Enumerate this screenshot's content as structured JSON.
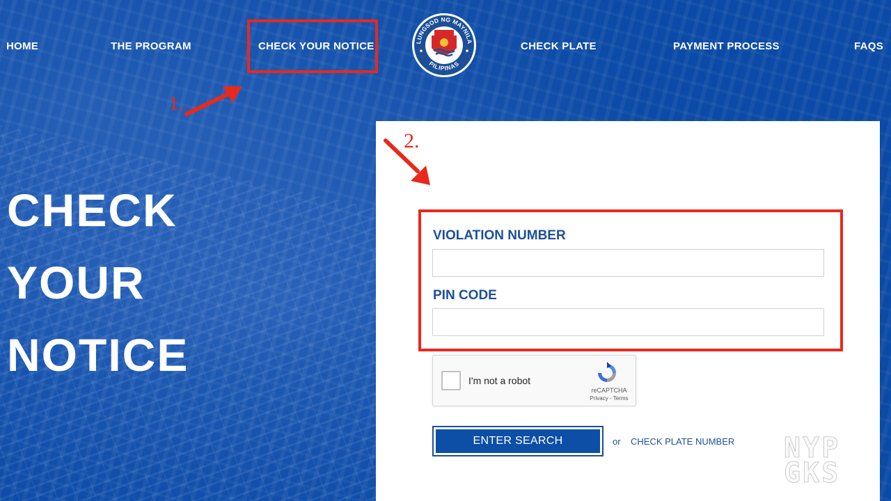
{
  "nav": {
    "items": [
      {
        "label": "HOME"
      },
      {
        "label": "THE PROGRAM"
      },
      {
        "label": "CHECK YOUR NOTICE"
      },
      {
        "label": "CHECK PLATE"
      },
      {
        "label": "PAYMENT PROCESS"
      },
      {
        "label": "FAQS"
      }
    ],
    "logo": {
      "top_text": "LUNGSOD NG MAYNILA",
      "bottom_text": "PILIPINAS"
    }
  },
  "annotations": {
    "step1": "1.",
    "step2": "2."
  },
  "hero": {
    "lines": [
      "CHECK",
      "YOUR",
      "NOTICE"
    ]
  },
  "form": {
    "violation_label": "VIOLATION NUMBER",
    "violation_value": "",
    "pin_label": "PIN CODE",
    "pin_value": "",
    "recaptcha": {
      "label": "I'm not a robot",
      "brand": "reCAPTCHA",
      "terms": "Privacy - Terms"
    },
    "search_button": "ENTER SEARCH",
    "or_text": "or",
    "plate_link": "CHECK PLATE NUMBER"
  },
  "watermark": {
    "lines": [
      "NYP",
      "GKS"
    ]
  },
  "colors": {
    "background": "#0b4aa6",
    "annotation_red": "#e8291c",
    "label_blue": "#1c4f98",
    "button_blue": "#0d4ea6"
  }
}
